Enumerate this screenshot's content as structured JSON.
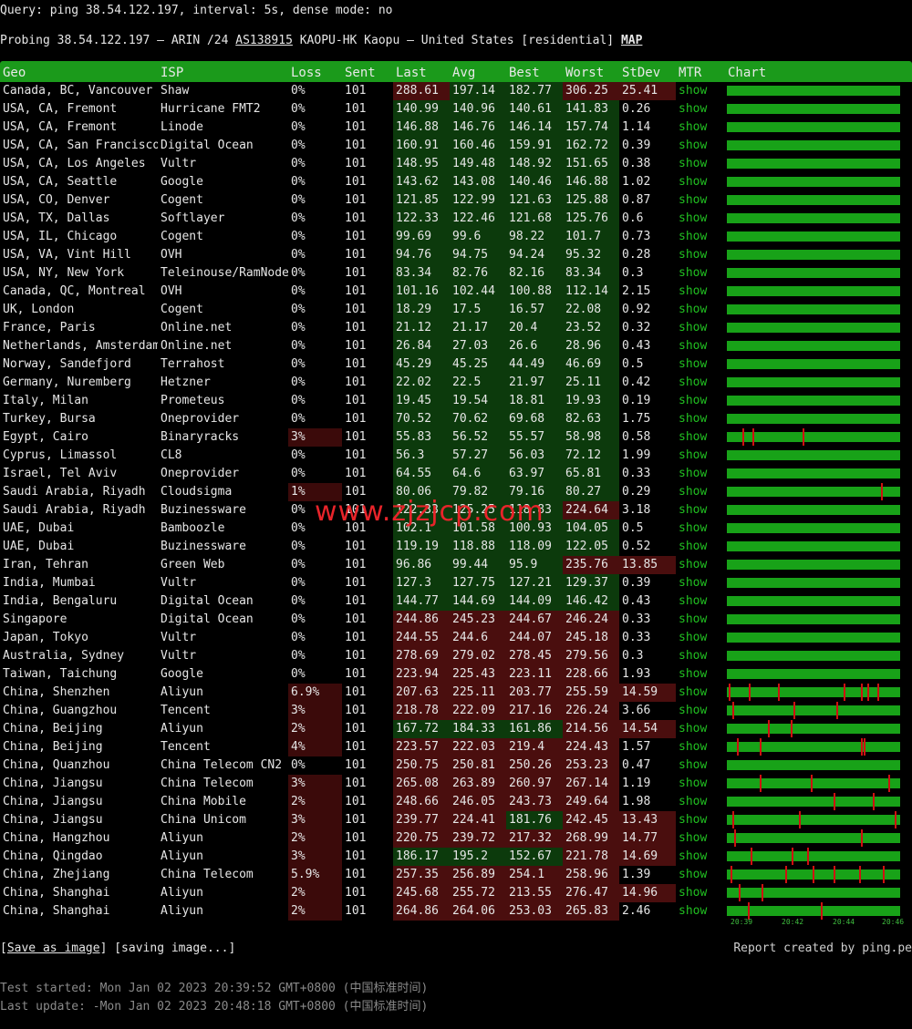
{
  "query": "Query: ping 38.54.122.197, interval: 5s, dense mode: no",
  "probe": {
    "prefix": "Probing 38.54.122.197 – ARIN /24 ",
    "asn": "AS138915",
    "middle": " KAOPU-HK Kaopu – United States [residential] ",
    "map": "MAP"
  },
  "headers": [
    "Geo",
    "ISP",
    "Loss",
    "Sent",
    "Last",
    "Avg",
    "Best",
    "Worst",
    "StDev",
    "MTR",
    "Chart"
  ],
  "colors": {
    "header": "#1b9a1b",
    "good": "#0c3a0c",
    "bad": "#4a0e0e",
    "warn": "#3b0a0a",
    "mtr": "#21c021",
    "chart": "#18a218",
    "spike": "#d01010"
  },
  "rows": [
    {
      "geo": "Canada, BC, Vancouver",
      "isp": "Shaw",
      "loss": "0%",
      "sent": "101",
      "last": "288.61",
      "avg": "197.14",
      "best": "182.77",
      "worst": "306.25",
      "stdev": "25.41",
      "mtr": "show",
      "spikes": []
    },
    {
      "geo": "USA, CA, Fremont",
      "isp": "Hurricane FMT2",
      "loss": "0%",
      "sent": "101",
      "last": "140.99",
      "avg": "140.96",
      "best": "140.61",
      "worst": "141.83",
      "stdev": "0.26",
      "mtr": "show",
      "spikes": []
    },
    {
      "geo": "USA, CA, Fremont",
      "isp": "Linode",
      "loss": "0%",
      "sent": "101",
      "last": "146.88",
      "avg": "146.76",
      "best": "146.14",
      "worst": "157.74",
      "stdev": "1.14",
      "mtr": "show",
      "spikes": []
    },
    {
      "geo": "USA, CA, San Francisco",
      "isp": "Digital Ocean",
      "loss": "0%",
      "sent": "101",
      "last": "160.91",
      "avg": "160.46",
      "best": "159.91",
      "worst": "162.72",
      "stdev": "0.39",
      "mtr": "show",
      "spikes": []
    },
    {
      "geo": "USA, CA, Los Angeles",
      "isp": "Vultr",
      "loss": "0%",
      "sent": "101",
      "last": "148.95",
      "avg": "149.48",
      "best": "148.92",
      "worst": "151.65",
      "stdev": "0.38",
      "mtr": "show",
      "spikes": []
    },
    {
      "geo": "USA, CA, Seattle",
      "isp": "Google",
      "loss": "0%",
      "sent": "101",
      "last": "143.62",
      "avg": "143.08",
      "best": "140.46",
      "worst": "146.88",
      "stdev": "1.02",
      "mtr": "show",
      "spikes": []
    },
    {
      "geo": "USA, CO, Denver",
      "isp": "Cogent",
      "loss": "0%",
      "sent": "101",
      "last": "121.85",
      "avg": "122.99",
      "best": "121.63",
      "worst": "125.88",
      "stdev": "0.87",
      "mtr": "show",
      "spikes": []
    },
    {
      "geo": "USA, TX, Dallas",
      "isp": "Softlayer",
      "loss": "0%",
      "sent": "101",
      "last": "122.33",
      "avg": "122.46",
      "best": "121.68",
      "worst": "125.76",
      "stdev": "0.6",
      "mtr": "show",
      "spikes": []
    },
    {
      "geo": "USA, IL, Chicago",
      "isp": "Cogent",
      "loss": "0%",
      "sent": "101",
      "last": "99.69",
      "avg": "99.6",
      "best": "98.22",
      "worst": "101.7",
      "stdev": "0.73",
      "mtr": "show",
      "spikes": []
    },
    {
      "geo": "USA, VA, Vint Hill",
      "isp": "OVH",
      "loss": "0%",
      "sent": "101",
      "last": "94.76",
      "avg": "94.75",
      "best": "94.24",
      "worst": "95.32",
      "stdev": "0.28",
      "mtr": "show",
      "spikes": []
    },
    {
      "geo": "USA, NY, New York",
      "isp": "Teleinouse/RamNode",
      "loss": "0%",
      "sent": "101",
      "last": "83.34",
      "avg": "82.76",
      "best": "82.16",
      "worst": "83.34",
      "stdev": "0.3",
      "mtr": "show",
      "spikes": []
    },
    {
      "geo": "Canada, QC, Montreal",
      "isp": "OVH",
      "loss": "0%",
      "sent": "101",
      "last": "101.16",
      "avg": "102.44",
      "best": "100.88",
      "worst": "112.14",
      "stdev": "2.15",
      "mtr": "show",
      "spikes": []
    },
    {
      "geo": "UK, London",
      "isp": "Cogent",
      "loss": "0%",
      "sent": "101",
      "last": "18.29",
      "avg": "17.5",
      "best": "16.57",
      "worst": "22.08",
      "stdev": "0.92",
      "mtr": "show",
      "spikes": []
    },
    {
      "geo": "France, Paris",
      "isp": "Online.net",
      "loss": "0%",
      "sent": "101",
      "last": "21.12",
      "avg": "21.17",
      "best": "20.4",
      "worst": "23.52",
      "stdev": "0.32",
      "mtr": "show",
      "spikes": []
    },
    {
      "geo": "Netherlands, Amsterdam",
      "isp": "Online.net",
      "loss": "0%",
      "sent": "101",
      "last": "26.84",
      "avg": "27.03",
      "best": "26.6",
      "worst": "28.96",
      "stdev": "0.43",
      "mtr": "show",
      "spikes": []
    },
    {
      "geo": "Norway, Sandefjord",
      "isp": "Terrahost",
      "loss": "0%",
      "sent": "101",
      "last": "45.29",
      "avg": "45.25",
      "best": "44.49",
      "worst": "46.69",
      "stdev": "0.5",
      "mtr": "show",
      "spikes": []
    },
    {
      "geo": "Germany, Nuremberg",
      "isp": "Hetzner",
      "loss": "0%",
      "sent": "101",
      "last": "22.02",
      "avg": "22.5",
      "best": "21.97",
      "worst": "25.11",
      "stdev": "0.42",
      "mtr": "show",
      "spikes": []
    },
    {
      "geo": "Italy, Milan",
      "isp": "Prometeus",
      "loss": "0%",
      "sent": "101",
      "last": "19.45",
      "avg": "19.54",
      "best": "18.81",
      "worst": "19.93",
      "stdev": "0.19",
      "mtr": "show",
      "spikes": []
    },
    {
      "geo": "Turkey, Bursa",
      "isp": "Oneprovider",
      "loss": "0%",
      "sent": "101",
      "last": "70.52",
      "avg": "70.62",
      "best": "69.68",
      "worst": "82.63",
      "stdev": "1.75",
      "mtr": "show",
      "spikes": []
    },
    {
      "geo": "Egypt, Cairo",
      "isp": "Binaryracks",
      "loss": "3%",
      "sent": "101",
      "last": "55.83",
      "avg": "56.52",
      "best": "55.57",
      "worst": "58.98",
      "stdev": "0.58",
      "mtr": "show",
      "spikes": [
        0.09,
        0.15,
        0.44
      ]
    },
    {
      "geo": "Cyprus, Limassol",
      "isp": "CL8",
      "loss": "0%",
      "sent": "101",
      "last": "56.3",
      "avg": "57.27",
      "best": "56.03",
      "worst": "72.12",
      "stdev": "1.99",
      "mtr": "show",
      "spikes": []
    },
    {
      "geo": "Israel, Tel Aviv",
      "isp": "Oneprovider",
      "loss": "0%",
      "sent": "101",
      "last": "64.55",
      "avg": "64.6",
      "best": "63.97",
      "worst": "65.81",
      "stdev": "0.33",
      "mtr": "show",
      "spikes": []
    },
    {
      "geo": "Saudi Arabia, Riyadh",
      "isp": "Cloudsigma",
      "loss": "1%",
      "sent": "101",
      "last": "80.06",
      "avg": "79.82",
      "best": "79.16",
      "worst": "80.27",
      "stdev": "0.29",
      "mtr": "show",
      "spikes": [
        0.9
      ]
    },
    {
      "geo": "Saudi Arabia, Riyadh",
      "isp": "Buzinessware",
      "loss": "0%",
      "sent": "101",
      "last": "122.33",
      "avg": "125.25",
      "best": "118.83",
      "worst": "224.64",
      "stdev": "3.18",
      "mtr": "show",
      "spikes": []
    },
    {
      "geo": "UAE, Dubai",
      "isp": "Bamboozle",
      "loss": "0%",
      "sent": "101",
      "last": "102.1",
      "avg": "101.58",
      "best": "100.93",
      "worst": "104.05",
      "stdev": "0.5",
      "mtr": "show",
      "spikes": []
    },
    {
      "geo": "UAE, Dubai",
      "isp": "Buzinessware",
      "loss": "0%",
      "sent": "101",
      "last": "119.19",
      "avg": "118.88",
      "best": "118.09",
      "worst": "122.05",
      "stdev": "0.52",
      "mtr": "show",
      "spikes": []
    },
    {
      "geo": "Iran, Tehran",
      "isp": "Green Web",
      "loss": "0%",
      "sent": "101",
      "last": "96.86",
      "avg": "99.44",
      "best": "95.9",
      "worst": "235.76",
      "stdev": "13.85",
      "mtr": "show",
      "spikes": []
    },
    {
      "geo": "India, Mumbai",
      "isp": "Vultr",
      "loss": "0%",
      "sent": "101",
      "last": "127.3",
      "avg": "127.75",
      "best": "127.21",
      "worst": "129.37",
      "stdev": "0.39",
      "mtr": "show",
      "spikes": []
    },
    {
      "geo": "India, Bengaluru",
      "isp": "Digital Ocean",
      "loss": "0%",
      "sent": "101",
      "last": "144.77",
      "avg": "144.69",
      "best": "144.09",
      "worst": "146.42",
      "stdev": "0.43",
      "mtr": "show",
      "spikes": []
    },
    {
      "geo": "Singapore",
      "isp": "Digital Ocean",
      "loss": "0%",
      "sent": "101",
      "last": "244.86",
      "avg": "245.23",
      "best": "244.67",
      "worst": "246.24",
      "stdev": "0.33",
      "mtr": "show",
      "spikes": []
    },
    {
      "geo": "Japan, Tokyo",
      "isp": "Vultr",
      "loss": "0%",
      "sent": "101",
      "last": "244.55",
      "avg": "244.6",
      "best": "244.07",
      "worst": "245.18",
      "stdev": "0.33",
      "mtr": "show",
      "spikes": []
    },
    {
      "geo": "Australia, Sydney",
      "isp": "Vultr",
      "loss": "0%",
      "sent": "101",
      "last": "278.69",
      "avg": "279.02",
      "best": "278.45",
      "worst": "279.56",
      "stdev": "0.3",
      "mtr": "show",
      "spikes": []
    },
    {
      "geo": "Taiwan, Taichung",
      "isp": "Google",
      "loss": "0%",
      "sent": "101",
      "last": "223.94",
      "avg": "225.43",
      "best": "223.11",
      "worst": "228.66",
      "stdev": "1.93",
      "mtr": "show",
      "spikes": []
    },
    {
      "geo": "China, Shenzhen",
      "isp": "Aliyun",
      "loss": "6.9%",
      "sent": "101",
      "last": "207.63",
      "avg": "225.11",
      "best": "203.77",
      "worst": "255.59",
      "stdev": "14.59",
      "mtr": "show",
      "spikes": [
        0.01,
        0.13,
        0.3,
        0.68,
        0.78,
        0.82,
        0.88
      ]
    },
    {
      "geo": "China, Guangzhou",
      "isp": "Tencent",
      "loss": "3%",
      "sent": "101",
      "last": "218.78",
      "avg": "222.09",
      "best": "217.16",
      "worst": "226.24",
      "stdev": "3.66",
      "mtr": "show",
      "spikes": [
        0.03,
        0.39,
        0.64
      ]
    },
    {
      "geo": "China, Beijing",
      "isp": "Aliyun",
      "loss": "2%",
      "sent": "101",
      "last": "167.72",
      "avg": "184.33",
      "best": "161.86",
      "worst": "214.56",
      "stdev": "14.54",
      "mtr": "show",
      "spikes": [
        0.24,
        0.37
      ]
    },
    {
      "geo": "China, Beijing",
      "isp": "Tencent",
      "loss": "4%",
      "sent": "101",
      "last": "223.57",
      "avg": "222.03",
      "best": "219.4",
      "worst": "224.43",
      "stdev": "1.57",
      "mtr": "show",
      "spikes": [
        0.06,
        0.19,
        0.78,
        0.8
      ]
    },
    {
      "geo": "China, Quanzhou",
      "isp": "China Telecom CN2",
      "loss": "0%",
      "sent": "101",
      "last": "250.75",
      "avg": "250.81",
      "best": "250.26",
      "worst": "253.23",
      "stdev": "0.47",
      "mtr": "show",
      "spikes": []
    },
    {
      "geo": "China, Jiangsu",
      "isp": "China Telecom",
      "loss": "3%",
      "sent": "101",
      "last": "265.08",
      "avg": "263.89",
      "best": "260.97",
      "worst": "267.14",
      "stdev": "1.19",
      "mtr": "show",
      "spikes": [
        0.19,
        0.49,
        0.94
      ]
    },
    {
      "geo": "China, Jiangsu",
      "isp": "China Mobile",
      "loss": "2%",
      "sent": "101",
      "last": "248.66",
      "avg": "246.05",
      "best": "243.73",
      "worst": "249.64",
      "stdev": "1.98",
      "mtr": "show",
      "spikes": [
        0.62,
        0.85
      ]
    },
    {
      "geo": "China, Jiangsu",
      "isp": "China Unicom",
      "loss": "3%",
      "sent": "101",
      "last": "239.77",
      "avg": "224.41",
      "best": "181.76",
      "worst": "242.45",
      "stdev": "13.43",
      "mtr": "show",
      "spikes": [
        0.03,
        0.42,
        0.98
      ]
    },
    {
      "geo": "China, Hangzhou",
      "isp": "Aliyun",
      "loss": "2%",
      "sent": "101",
      "last": "220.75",
      "avg": "239.72",
      "best": "217.32",
      "worst": "268.99",
      "stdev": "14.77",
      "mtr": "show",
      "spikes": [
        0.04,
        0.78
      ]
    },
    {
      "geo": "China, Qingdao",
      "isp": "Aliyun",
      "loss": "3%",
      "sent": "101",
      "last": "186.17",
      "avg": "195.2",
      "best": "152.67",
      "worst": "221.78",
      "stdev": "14.69",
      "mtr": "show",
      "spikes": [
        0.14,
        0.38,
        0.47
      ]
    },
    {
      "geo": "China, Zhejiang",
      "isp": "China Telecom",
      "loss": "5.9%",
      "sent": "101",
      "last": "257.35",
      "avg": "256.89",
      "best": "254.1",
      "worst": "258.96",
      "stdev": "1.39",
      "mtr": "show",
      "spikes": [
        0.02,
        0.34,
        0.5,
        0.62,
        0.77,
        0.91
      ]
    },
    {
      "geo": "China, Shanghai",
      "isp": "Aliyun",
      "loss": "2%",
      "sent": "101",
      "last": "245.68",
      "avg": "255.72",
      "best": "213.55",
      "worst": "276.47",
      "stdev": "14.96",
      "mtr": "show",
      "spikes": [
        0.07,
        0.2
      ]
    },
    {
      "geo": "China, Shanghai",
      "isp": "Aliyun",
      "loss": "2%",
      "sent": "101",
      "last": "264.86",
      "avg": "264.06",
      "best": "253.03",
      "worst": "265.83",
      "stdev": "2.46",
      "mtr": "show",
      "spikes": [
        0.12,
        0.55
      ]
    }
  ],
  "time_ticks": [
    "20:39",
    "20:42",
    "20:44",
    "20:46"
  ],
  "footer": {
    "save_prefix": "[",
    "save_link": "Save as image",
    "save_suffix": "] [saving image...]",
    "report": "Report created by ping.pe",
    "started": "Test started: Mon Jan 02 2023 20:39:52 GMT+0800 (中国标准时间)",
    "updated": "Last update: -Mon Jan 02 2023 20:48:18 GMT+0800 (中国标准时间)"
  },
  "watermark": "www.zjzjcp.com"
}
